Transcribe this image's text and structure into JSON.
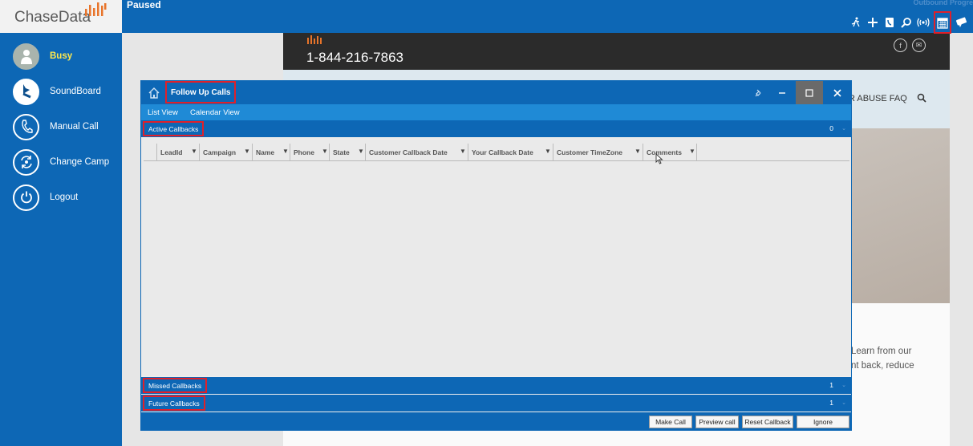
{
  "app": {
    "logo_text": "ChaseData",
    "status": "Paused",
    "outbound_text": "Outbound Progre"
  },
  "colors": {
    "primary": "#0d67b5",
    "highlight_border": "#e0202a",
    "busy_text": "#ffe94d"
  },
  "sidebar": {
    "items": [
      {
        "label": "Busy",
        "icon": "avatar-icon"
      },
      {
        "label": "SoundBoard",
        "icon": "soundboard-icon"
      },
      {
        "label": "Manual Call",
        "icon": "phone-icon"
      },
      {
        "label": "Change Camp",
        "icon": "change-campaign-icon"
      },
      {
        "label": "Logout",
        "icon": "power-icon"
      }
    ]
  },
  "toolbar": {
    "icons": [
      "running-person-icon",
      "add-icon",
      "phonebook-icon",
      "search-icon",
      "broadcast-icon",
      "calendar-icon",
      "chat-icon"
    ]
  },
  "website": {
    "phone": "1-844-216-7863",
    "nav_text": "R ABUSE FAQ",
    "body_line1": "Learn from our",
    "body_line2": "nt back, reduce"
  },
  "modal": {
    "title": "Follow Up Calls",
    "tabs": [
      "List View",
      "Calendar View"
    ],
    "sections": {
      "active": {
        "label": "Active Callbacks",
        "count": "0"
      },
      "missed": {
        "label": "Missed Callbacks",
        "count": "1"
      },
      "future": {
        "label": "Future Callbacks",
        "count": "1"
      }
    },
    "columns": [
      "LeadId",
      "Campaign",
      "Name",
      "Phone",
      "State",
      "Customer Callback Date",
      "Your Callback Date",
      "Customer TimeZone",
      "Comments"
    ],
    "buttons": {
      "make_call": "Make Call",
      "preview_call": "Preview call",
      "reset_callback": "Reset Callback",
      "ignore": "Ignore"
    }
  }
}
